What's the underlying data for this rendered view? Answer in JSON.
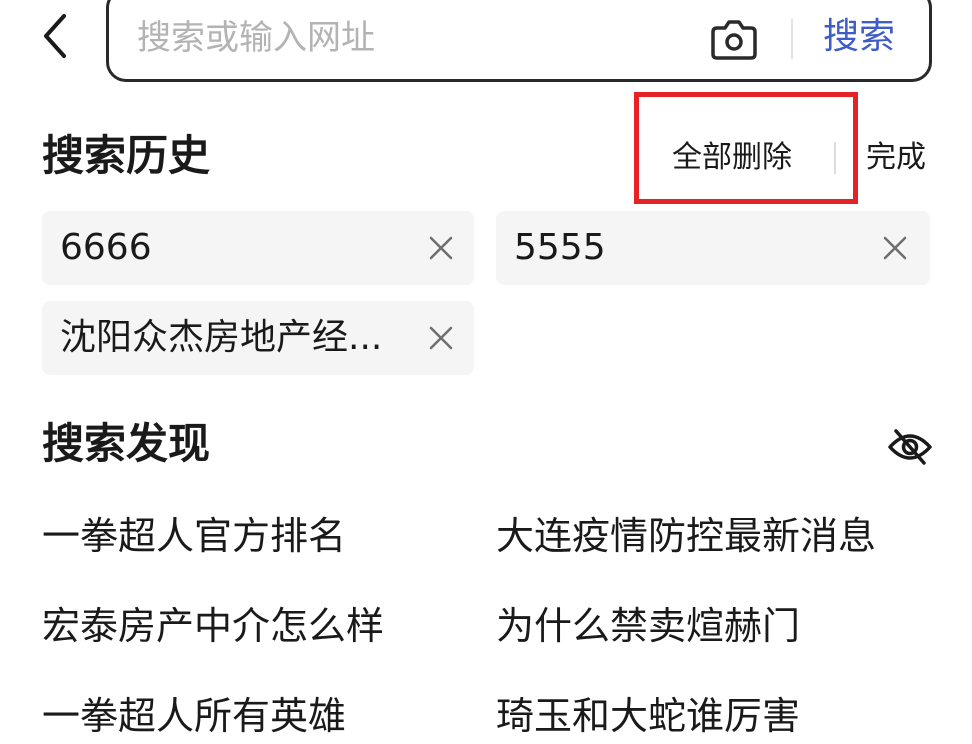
{
  "search": {
    "placeholder": "搜索或输入网址",
    "value": "",
    "submit_label": "搜索"
  },
  "icons": {
    "back": "chevron-left-icon",
    "camera": "camera-icon",
    "clear": "close-icon",
    "hide": "eye-slash-icon"
  },
  "history": {
    "title": "搜索历史",
    "delete_all_label": "全部删除",
    "done_label": "完成",
    "items": [
      {
        "text": "6666"
      },
      {
        "text": "5555"
      },
      {
        "text": "沈阳众杰房地产经..."
      }
    ]
  },
  "discover": {
    "title": "搜索发现",
    "items": [
      {
        "text": "一拳超人官方排名"
      },
      {
        "text": "大连疫情防控最新消息"
      },
      {
        "text": "宏泰房产中介怎么样"
      },
      {
        "text": "为什么禁卖煊赫门"
      },
      {
        "text": "一拳超人所有英雄"
      },
      {
        "text": "琦玉和大蛇谁厉害"
      }
    ]
  },
  "colors": {
    "accent": "#3d5cc7",
    "highlight_border": "#e52226",
    "chip_background": "#f5f5f5",
    "placeholder": "#b3b3b3",
    "text": "#1a1a1a"
  }
}
